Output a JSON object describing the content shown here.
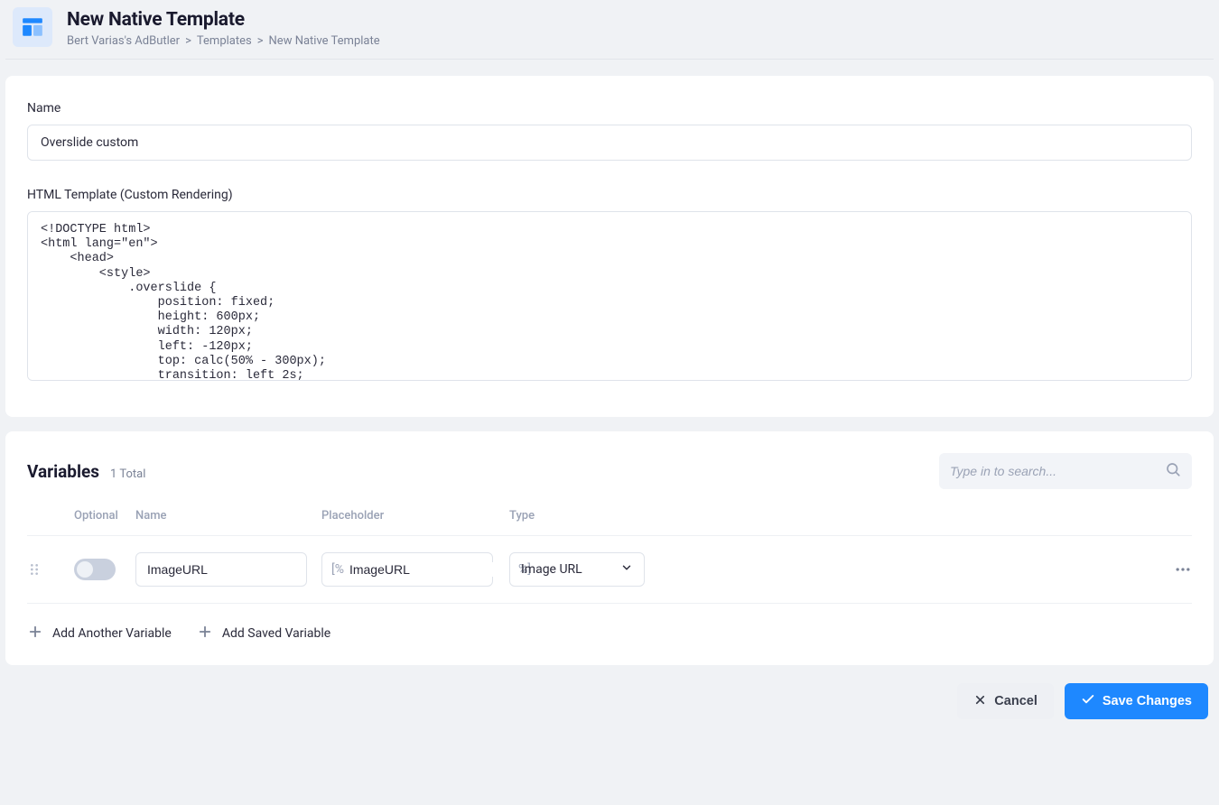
{
  "header": {
    "title": "New Native Template",
    "breadcrumb": {
      "root": "Bert Varias's AdButler",
      "mid": "Templates",
      "current": "New Native Template"
    }
  },
  "form": {
    "name_label": "Name",
    "name_value": "Overslide custom",
    "html_label": "HTML Template (Custom Rendering)",
    "html_value": "<!DOCTYPE html>\n<html lang=\"en\">\n    <head>\n        <style>\n            .overslide {\n                position: fixed;\n                height: 600px;\n                width: 120px;\n                left: -120px;\n                top: calc(50% - 300px);\n                transition: left 2s;"
  },
  "variables": {
    "title": "Variables",
    "count_label": "1 Total",
    "search_placeholder": "Type in to search...",
    "columns": {
      "optional": "Optional",
      "name": "Name",
      "placeholder": "Placeholder",
      "type": "Type"
    },
    "rows": [
      {
        "name_value": "ImageURL",
        "placeholder_prefix": "[%",
        "placeholder_value": "ImageURL",
        "placeholder_suffix": "%]",
        "type_value": "Image URL"
      }
    ],
    "add_another": "Add Another Variable",
    "add_saved": "Add Saved Variable"
  },
  "actions": {
    "cancel": "Cancel",
    "save": "Save Changes"
  }
}
